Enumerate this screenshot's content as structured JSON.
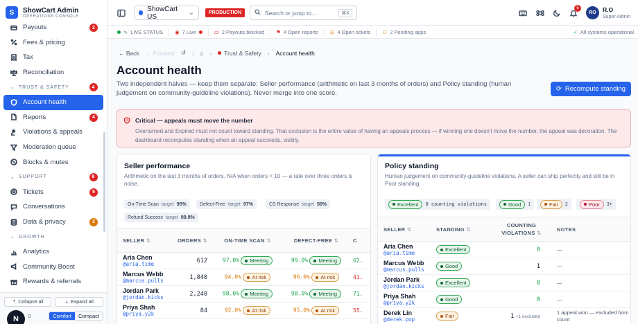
{
  "app": {
    "title": "ShowCart Admin",
    "subtitle": "OPERATIONS CONSOLE",
    "logo_letter": "S"
  },
  "sidebar": {
    "items": [
      {
        "label": "Payouts",
        "icon": "payouts-icon",
        "badge": "2"
      },
      {
        "label": "Fees & pricing",
        "icon": "percent-icon"
      },
      {
        "label": "Tax",
        "icon": "receipt-icon"
      },
      {
        "label": "Reconciliation",
        "icon": "scale-icon"
      }
    ],
    "sections": [
      {
        "label": "TRUST & SAFETY",
        "badge": "4",
        "items": [
          {
            "label": "Account health",
            "icon": "heart-shield-icon",
            "active": true
          },
          {
            "label": "Reports",
            "icon": "file-icon",
            "badge": "4"
          },
          {
            "label": "Violations & appeals",
            "icon": "gavel-icon"
          },
          {
            "label": "Moderation queue",
            "icon": "filter-icon"
          },
          {
            "label": "Blocks & mutes",
            "icon": "ban-icon"
          }
        ]
      },
      {
        "label": "SUPPORT",
        "badge": "8",
        "items": [
          {
            "label": "Tickets",
            "icon": "ticket-icon",
            "badge": "5"
          },
          {
            "label": "Conversations",
            "icon": "chat-icon"
          },
          {
            "label": "Data & privacy",
            "icon": "database-icon",
            "badge": "3"
          }
        ]
      },
      {
        "label": "GROWTH",
        "items": [
          {
            "label": "Analytics",
            "icon": "chart-icon"
          },
          {
            "label": "Community Boost",
            "icon": "megaphone-icon"
          },
          {
            "label": "Rewards & referrals",
            "icon": "gift-icon"
          }
        ]
      }
    ],
    "footer": {
      "collapse_all": "Collapse all",
      "expand_all": "Expand all",
      "density_label": "D",
      "comfort": "Comfort",
      "compact": "Compact",
      "fab": "N"
    }
  },
  "topbar": {
    "store": "ShowCart US",
    "env": "PRODUCTION",
    "search_placeholder": "Search or jump to…",
    "search_kbd": "⌘K",
    "notif_count": "5",
    "user_initials": "RO",
    "user_name": "R.O",
    "user_role": "Super Admin"
  },
  "statusbar": {
    "items": [
      {
        "label": "LIVE STATUS",
        "color": "#16a34a"
      },
      {
        "label": "7 Live",
        "color": "#dc2626"
      },
      {
        "label": "2 Payouts blocked",
        "color": "#dc2626"
      },
      {
        "label": "4 Open reports",
        "color": "#dc2626"
      },
      {
        "label": "4 Open tickets",
        "color": "#d97706"
      },
      {
        "label": "2 Pending apps",
        "color": "#d97706"
      }
    ],
    "right": "All systems operational"
  },
  "breadcrumb": {
    "back": "Back",
    "forward": "Forward",
    "section": "Trust & Safety",
    "current": "Account health"
  },
  "page": {
    "title": "Account health",
    "description": "Two independent halves — keep them separate: Seller performance (arithmetic on last 3 months of orders) and Policy standing (human judgement on community-guideline violations). Never merge into one score.",
    "recompute": "Recompute standing"
  },
  "alert": {
    "title": "Critical — appeals must move the number",
    "body": "Overturned and Expired must not count toward standing. That exclusion is the entire value of having an appeals process — if winning one doesn't move the number, the appeal was decoration. The dashboard recomputes standing when an appeal succeeds, visibly."
  },
  "seller_performance": {
    "title": "Seller performance",
    "subtitle": "Arithmetic on the last 3 months of orders. N/A when orders < 10 — a rate over three orders is noise.",
    "targets": [
      {
        "label": "On-Time Scan",
        "target_word": "target",
        "value": "95%"
      },
      {
        "label": "Defect-Free",
        "target_word": "target",
        "value": "97%"
      },
      {
        "label": "CS Response",
        "target_word": "target",
        "value": "50%"
      },
      {
        "label": "Refund Success",
        "target_word": "target",
        "value": "99.9%"
      }
    ],
    "columns": [
      "SELLER",
      "ORDERS",
      "ON-TIME SCAN",
      "DEFECT-FREE",
      "C"
    ],
    "rows": [
      {
        "name": "Aria Chen",
        "handle": "@aria.time",
        "orders": "612",
        "ots": "97.0%",
        "ots_status": "Meeting",
        "df": "99.0%",
        "df_status": "Meeting",
        "cs": "62."
      },
      {
        "name": "Marcus Webb",
        "handle": "@marcus.pulls",
        "orders": "1,840",
        "ots": "94.0%",
        "ots_status": "At risk",
        "df": "96.0%",
        "df_status": "At risk",
        "cs": "41."
      },
      {
        "name": "Jordan Park",
        "handle": "@jordan.kicks",
        "orders": "2,240",
        "ots": "98.0%",
        "ots_status": "Meeting",
        "df": "98.0%",
        "df_status": "Meeting",
        "cs": "71."
      },
      {
        "name": "Priya Shah",
        "handle": "@priya.y2k",
        "orders": "84",
        "ots": "92.0%",
        "ots_status": "At risk",
        "df": "95.0%",
        "df_status": "At risk",
        "cs": "55."
      },
      {
        "name": "Derek Lin",
        "handle": "",
        "orders": "",
        "ots": "",
        "ots_status": "",
        "df": "",
        "df_status": "",
        "cs": ""
      }
    ]
  },
  "policy_standing": {
    "title": "Policy standing",
    "subtitle": "Human judgement on community-guideline violations. A seller can ship perfectly and still be in Poor standing.",
    "legend": [
      {
        "label": "Excellent",
        "range": "0 counting violations"
      },
      {
        "label": "Good",
        "range": "1"
      },
      {
        "label": "Fair",
        "range": "2"
      },
      {
        "label": "Poor",
        "range": "3+"
      }
    ],
    "columns": [
      "SELLER",
      "STANDING",
      "COUNTING VIOLATIONS",
      "NOTES"
    ],
    "rows": [
      {
        "name": "Aria Chen",
        "handle": "@aria.time",
        "standing": "Excellent",
        "count": "0",
        "extra": "",
        "notes": "—"
      },
      {
        "name": "Marcus Webb",
        "handle": "@marcus.pulls",
        "standing": "Good",
        "count": "1",
        "extra": "",
        "notes": "—"
      },
      {
        "name": "Jordan Park",
        "handle": "@jordan.kicks",
        "standing": "Excellent",
        "count": "0",
        "extra": "",
        "notes": "—"
      },
      {
        "name": "Priya Shah",
        "handle": "@priya.y2k",
        "standing": "Good",
        "count": "0",
        "extra": "",
        "notes": "—"
      },
      {
        "name": "Derek Lin",
        "handle": "@derek.pop",
        "standing": "Fair",
        "count": "1",
        "extra": "+1 excluded",
        "notes": "1 appeal won — excluded from count"
      }
    ]
  }
}
